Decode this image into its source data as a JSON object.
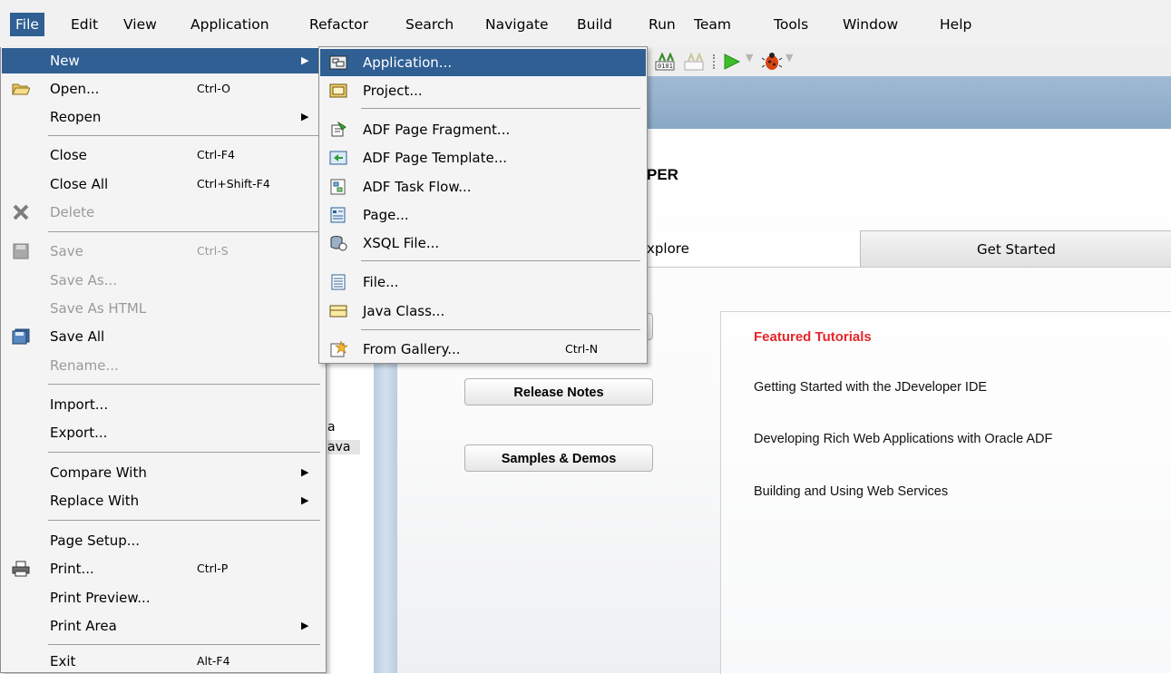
{
  "menubar": [
    "File",
    "Edit",
    "View",
    "Application",
    "Refactor",
    "Search",
    "Navigate",
    "Build",
    "Run",
    "Team",
    "Tools",
    "Window",
    "Help"
  ],
  "file_menu": {
    "new": "New",
    "open": "Open...",
    "open_sc": "Ctrl-O",
    "reopen": "Reopen",
    "close": "Close",
    "close_sc": "Ctrl-F4",
    "close_all": "Close All",
    "close_all_sc": "Ctrl+Shift-F4",
    "delete": "Delete",
    "save": "Save",
    "save_sc": "Ctrl-S",
    "save_as": "Save As...",
    "save_as_html": "Save As HTML",
    "save_all": "Save All",
    "rename": "Rename...",
    "import": "Import...",
    "export": "Export...",
    "compare_with": "Compare With",
    "replace_with": "Replace With",
    "page_setup": "Page Setup...",
    "print": "Print...",
    "print_sc": "Ctrl-P",
    "print_preview": "Print Preview...",
    "print_area": "Print Area",
    "exit": "Exit",
    "exit_sc": "Alt-F4"
  },
  "new_submenu": {
    "application": "Application...",
    "project": "Project...",
    "adf_page_fragment": "ADF Page Fragment...",
    "adf_page_template": "ADF Page Template...",
    "adf_task_flow": "ADF Task Flow...",
    "page": "Page...",
    "xsql_file": "XSQL File...",
    "file": "File...",
    "java_class": "Java Class...",
    "from_gallery": "From Gallery...",
    "from_gallery_sc": "Ctrl-N"
  },
  "start_page": {
    "title_fragment": "PER",
    "tab_explore": "xplore",
    "tab_get_started": "Get Started",
    "release_notes": "Release Notes",
    "samples_demos": "Samples & Demos",
    "featured_title": "Featured Tutorials",
    "links": [
      "Getting Started with the JDeveloper IDE",
      "Developing Rich Web Applications with Oracle ADF",
      "Building and Using Web Services"
    ]
  },
  "left_fragments": [
    "a",
    "ava"
  ],
  "colors": {
    "highlight": "#2f5f93",
    "featured": "#e8262a",
    "band": "#9fbad4"
  },
  "icons": [
    "folder-open-icon",
    "delete-x-icon",
    "save-disk-icon",
    "save-all-icon",
    "printer-icon",
    "application-icon",
    "project-icon",
    "adf-fragment-icon",
    "adf-template-icon",
    "task-flow-icon",
    "page-icon",
    "xsql-icon",
    "file-icon",
    "java-class-icon",
    "gallery-icon",
    "compile-icon",
    "run-icon",
    "debug-icon"
  ]
}
